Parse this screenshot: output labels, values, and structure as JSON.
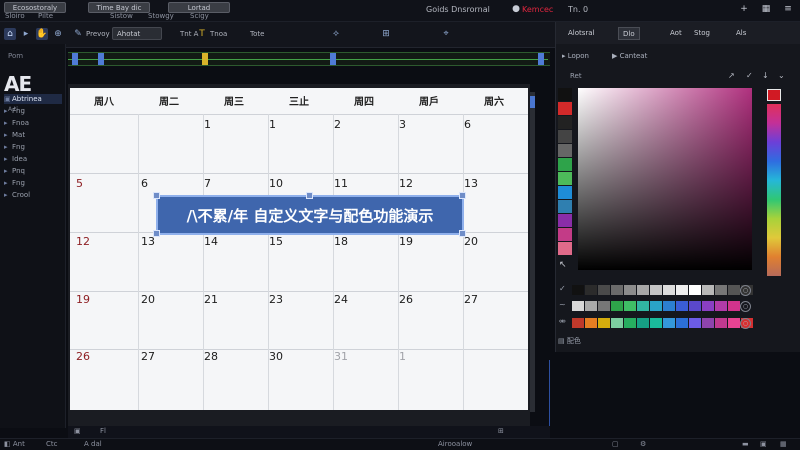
{
  "menubar": {
    "tabs": [
      "Ecosostoraly",
      "Time Bay dic",
      "Lortad"
    ],
    "submenus": [
      "Sloiro",
      "Pilte",
      "Sistow",
      "Stowgy",
      "Scigy"
    ],
    "right_title": "Goids Dnsrornal",
    "right_red": "Kemcec",
    "right_tab": "Tn. 0"
  },
  "toolbar": {
    "label1": "Prevoy",
    "box1": "Ahotat",
    "label2": "Tnt A",
    "label3": "Tnoa",
    "label4": "Tote"
  },
  "left_panel": {
    "title": "Pom",
    "sub": "A.ti",
    "logo": "AE",
    "items": [
      "Abtrinea",
      "Fng",
      "Fnoa",
      "Mat",
      "Fng",
      "Idea",
      "Pnq",
      "Fng",
      "Crool"
    ]
  },
  "calendar": {
    "headers": [
      "周八",
      "周二",
      "周三",
      "三止",
      "周四",
      "周戶",
      "周六"
    ],
    "rows": [
      [
        {
          "d": ""
        },
        {
          "d": ""
        },
        {
          "d": "1"
        },
        {
          "d": "1"
        },
        {
          "d": "2"
        },
        {
          "d": "3"
        },
        {
          "d": "6"
        }
      ],
      [
        {
          "d": "5",
          "c": "red"
        },
        {
          "d": "6"
        },
        {
          "d": "7"
        },
        {
          "d": "10"
        },
        {
          "d": "11"
        },
        {
          "d": "12"
        },
        {
          "d": "13"
        }
      ],
      [
        {
          "d": "12",
          "c": "red"
        },
        {
          "d": "13"
        },
        {
          "d": "14"
        },
        {
          "d": "15"
        },
        {
          "d": "18"
        },
        {
          "d": "19"
        },
        {
          "d": "20"
        }
      ],
      [
        {
          "d": "19",
          "c": "red"
        },
        {
          "d": "20"
        },
        {
          "d": "21"
        },
        {
          "d": "23"
        },
        {
          "d": "24"
        },
        {
          "d": "26"
        },
        {
          "d": "27"
        }
      ],
      [
        {
          "d": "26",
          "c": "red"
        },
        {
          "d": "27"
        },
        {
          "d": "28"
        },
        {
          "d": "30"
        },
        {
          "d": "31",
          "c": "grey"
        },
        {
          "d": "1",
          "c": "grey"
        },
        {
          "d": ""
        }
      ]
    ]
  },
  "banner": {
    "text": "/\\不累/年 自定义文字与配色功能演示"
  },
  "right_panel": {
    "tab1": "Alotsral",
    "tab2": "Dlo",
    "tab3": "Aot",
    "tab4": "Stog",
    "tab5": "Als",
    "sub1": "Lopon",
    "sub2": "Canteat",
    "picker_label": "Ret",
    "footer": "配色",
    "colors": {
      "strip": [
        "#111111",
        "#d32a2a",
        "#222222",
        "#444444",
        "#666666",
        "#2ea34a",
        "#4dbb5a",
        "#1e8dd8",
        "#2f7fb0",
        "#8a2da8",
        "#c33b87",
        "#e06a8a"
      ],
      "row1": [
        "#111111",
        "#2b2b2b",
        "#4a4a4a",
        "#6b6b6b",
        "#8c8c8c",
        "#a8a8a8",
        "#c4c4c4",
        "#dcdcdc",
        "#eeeeee",
        "#ffffff",
        "#b8b8b8",
        "#777777",
        "#555555",
        "#333333"
      ],
      "row2": [
        "#d8d8d8",
        "#aaaaaa",
        "#777777",
        "#2ea34a",
        "#3fbf66",
        "#31b5a2",
        "#2aa3c7",
        "#2c7fd0",
        "#3a5dd6",
        "#5a48cc",
        "#8a3fc4",
        "#b13ba8",
        "#d2338c"
      ],
      "row3": [
        "#c0392b",
        "#e67e22",
        "#d4ac0d",
        "#7dcea0",
        "#27ae60",
        "#16a085",
        "#1abc9c",
        "#3498db",
        "#2c6fd8",
        "#6c5ce7",
        "#8e44ad",
        "#c0398f",
        "#e84393",
        "#d63031"
      ]
    }
  },
  "statusbar": {
    "left": "Ant",
    "mid1": "Fl",
    "mid2": "A dal",
    "mid3": "Airooalow",
    "bottom_left": "Ctc"
  }
}
